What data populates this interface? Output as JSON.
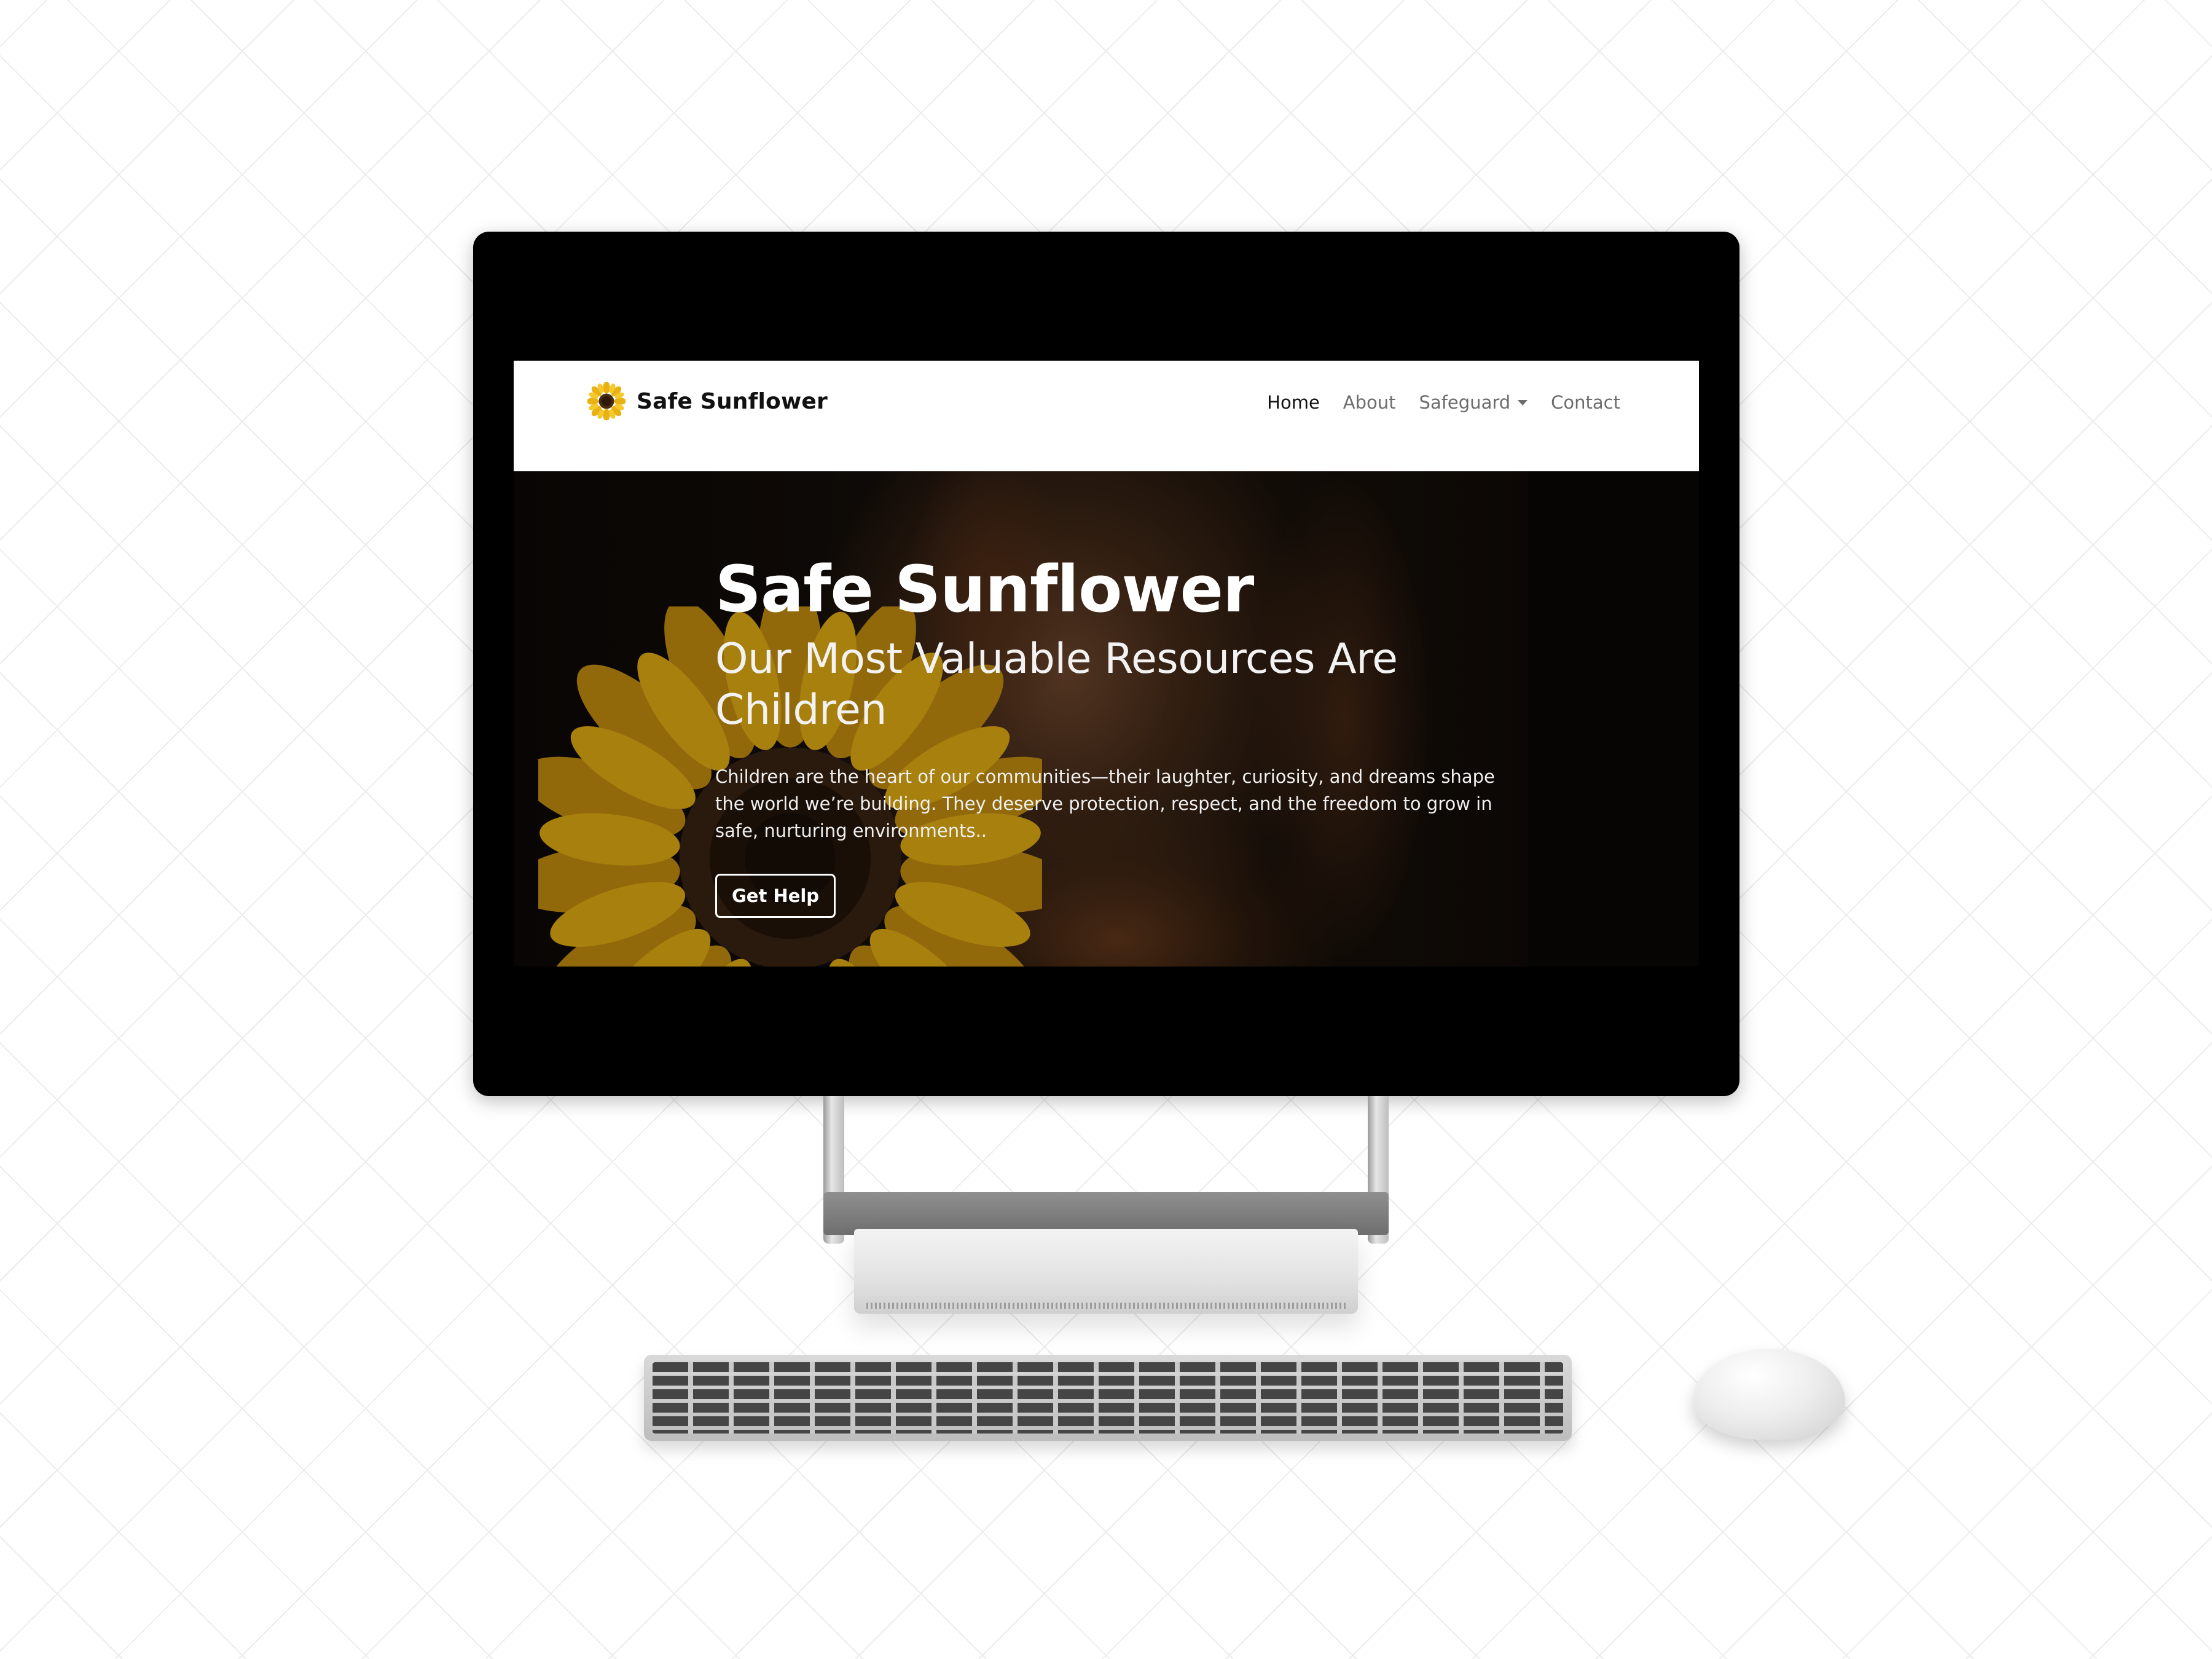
{
  "site": {
    "brand_name": "Safe Sunflower",
    "brand_icon": "sunflower-icon"
  },
  "nav": {
    "items": [
      {
        "label": "Home",
        "active": true
      },
      {
        "label": "About",
        "active": false
      },
      {
        "label": "Safeguard",
        "active": false,
        "dropdown": true
      },
      {
        "label": "Contact",
        "active": false
      }
    ]
  },
  "hero": {
    "title": "Safe Sunflower",
    "subtitle": "Our Most Valuable Resources Are Children",
    "body": "Children are the heart of our communities—their laughter, curiosity, and dreams shape the world we’re building. They deserve protection, respect, and the freedom to grow in safe, nurturing environments..",
    "button_label": "Get Help"
  },
  "colors": {
    "navbar_bg": "#ffffff",
    "nav_active": "#111111",
    "nav_inactive": "#6c6c6c",
    "hero_text": "#ffffff",
    "sunflower_petal": "#e8b214",
    "sunflower_center": "#3a2412"
  }
}
